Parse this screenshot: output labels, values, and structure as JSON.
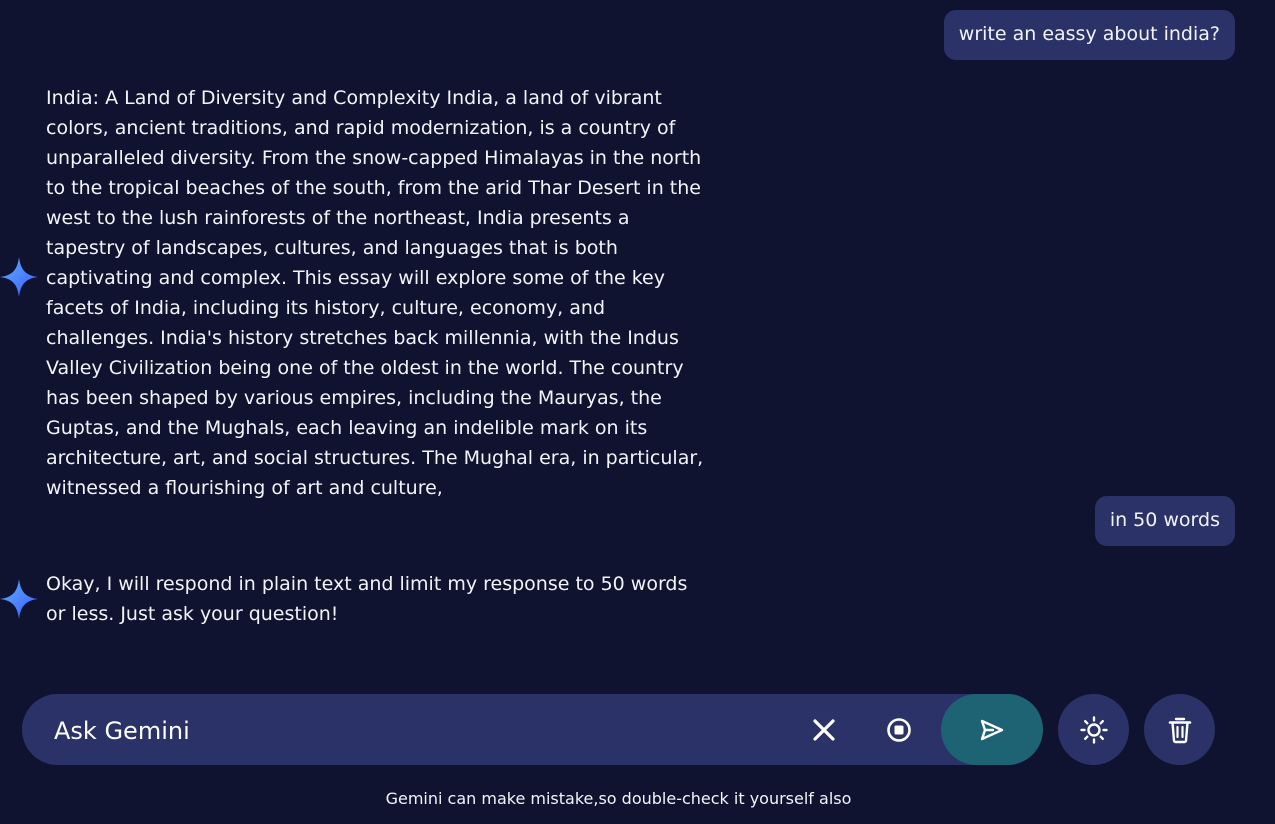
{
  "colors": {
    "background": "#0f1330",
    "bubble": "#2b3268",
    "send_button": "#1d6374",
    "spark_gradient": [
      "#3b6bff",
      "#5fb0ff"
    ]
  },
  "messages": [
    {
      "role": "user",
      "text": "write an eassy about india?"
    },
    {
      "role": "model",
      "icon": "gemini-spark-icon",
      "text": "India: A Land of Diversity and Complexity India, a land of vibrant colors, ancient traditions, and rapid modernization, is a country of unparalleled diversity. From the snow-capped Himalayas in the north to the tropical beaches of the south, from the arid Thar Desert in the west to the lush rainforests of the northeast, India presents a tapestry of landscapes, cultures, and languages that is both captivating and complex. This essay will explore some of the key facets of India, including its history, culture, economy, and challenges. India's history stretches back millennia, with the Indus Valley Civilization being one of the oldest in the world. The country has been shaped by various empires, including the Mauryas, the Guptas, and the Mughals, each leaving an indelible mark on its architecture, art, and social structures. The Mughal era, in particular, witnessed a flourishing of art and culture,"
    },
    {
      "role": "user",
      "text": "in 50 words"
    },
    {
      "role": "model",
      "icon": "gemini-spark-icon",
      "text": "Okay, I will respond in plain text and limit my response to 50 words or less. Just ask your question!"
    }
  ],
  "input": {
    "placeholder": "Ask Gemini",
    "value": ""
  },
  "toolbar": {
    "clear_icon": "close-icon",
    "stop_icon": "stop-icon",
    "send_icon": "send-icon",
    "theme_icon": "sun-icon",
    "delete_icon": "trash-icon"
  },
  "footer": {
    "disclaimer": "Gemini can make mistake,so double-check it yourself also"
  }
}
